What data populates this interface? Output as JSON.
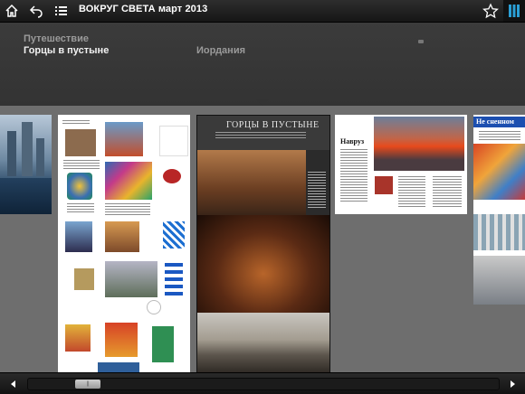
{
  "topbar": {
    "title": "ВОКРУГ СВЕТА март 2013",
    "icons": [
      "home-icon",
      "back-icon",
      "contents-icon",
      "bookmark-icon",
      "pages-view-icon"
    ]
  },
  "header": {
    "section": "Путешествие",
    "article": "Горцы в пустыне",
    "location": "Иордания"
  },
  "pages": {
    "main_title": "ГОРЦЫ В ПУСТЫНЕ",
    "page3_heading": "Навруз",
    "page4_heading": "Не сненном"
  },
  "scrubber": {
    "thumb_label": "||"
  },
  "colors": {
    "accent": "#2a9fd6",
    "bar": "#1a1a1a",
    "panel": "#363636",
    "background": "#6e6e6e"
  }
}
